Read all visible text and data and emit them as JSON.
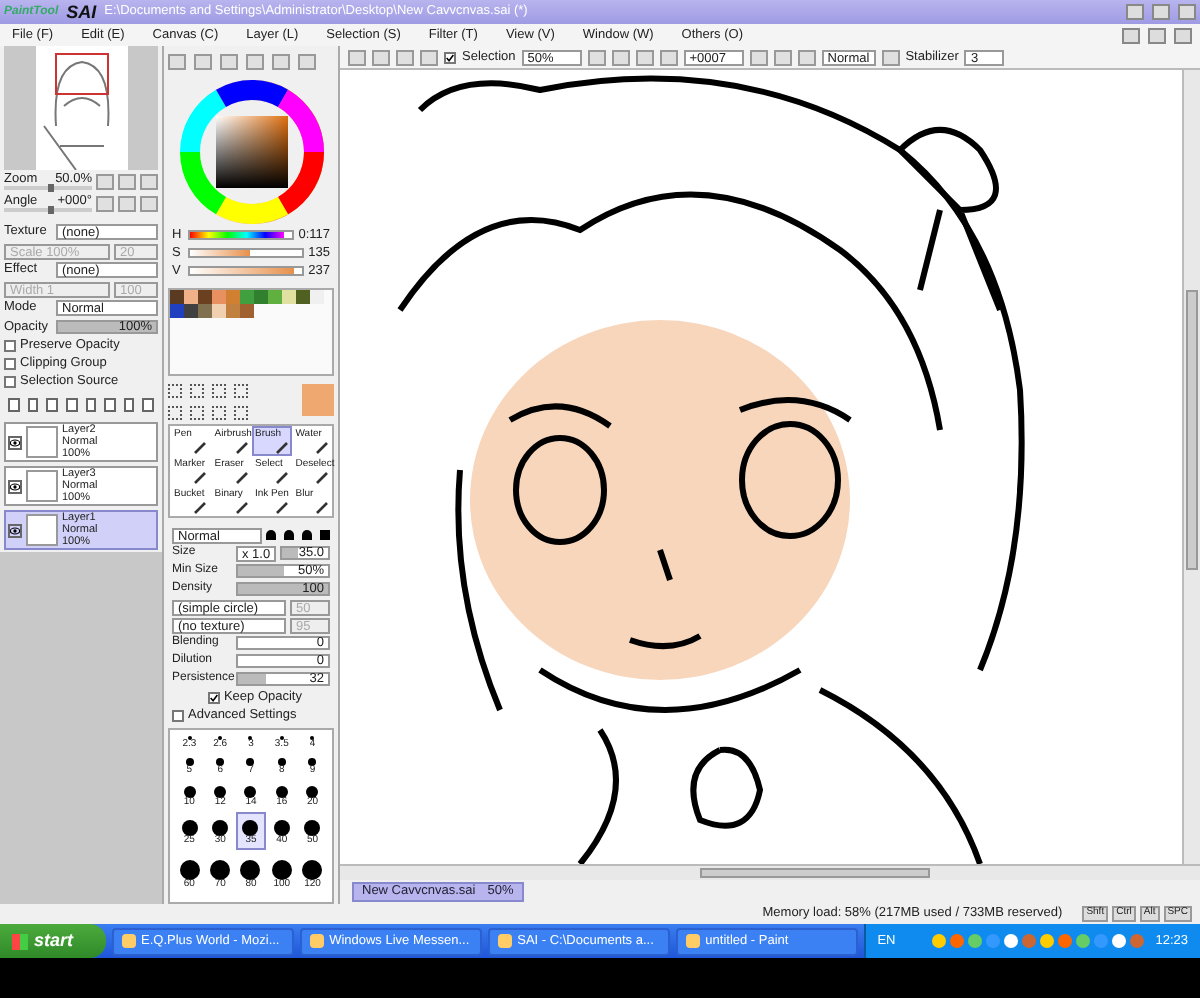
{
  "window": {
    "logo_small": "PaintTool",
    "logo": "SAI",
    "title": "E:\\Documents and Settings\\Administrator\\Desktop\\New Cavvcnvas.sai (*)"
  },
  "menu": [
    "File (F)",
    "Edit (E)",
    "Canvas (C)",
    "Layer (L)",
    "Selection (S)",
    "Filter (T)",
    "View (V)",
    "Window (W)",
    "Others (O)"
  ],
  "navigator": {
    "zoom": {
      "label": "Zoom",
      "value": "50.0%",
      "level": 0.5
    },
    "angle": {
      "label": "Angle",
      "value": "+000°",
      "level": 0.5
    }
  },
  "layer_props": {
    "fields": [
      {
        "label": "Texture",
        "value": "(none)",
        "sub_label": "Scale",
        "sub_value": "100%",
        "sub_extra": "20"
      },
      {
        "label": "Effect",
        "value": "(none)",
        "sub_label": "Width",
        "sub_value": "1",
        "sub_extra": "100"
      }
    ],
    "mode_label": "Mode",
    "mode": "Normal",
    "opacity": {
      "label": "Opacity",
      "value": "100%",
      "level": 1
    },
    "options": [
      {
        "label": "Preserve Opacity",
        "checked": false
      },
      {
        "label": "Clipping Group",
        "checked": false
      },
      {
        "label": "Selection Source",
        "checked": false
      }
    ]
  },
  "layers": [
    {
      "name": "Layer2",
      "mode": "Normal",
      "opacity": "100%",
      "visible": true,
      "selected": false
    },
    {
      "name": "Layer3",
      "mode": "Normal",
      "opacity": "100%",
      "visible": true,
      "selected": false
    },
    {
      "name": "Layer1",
      "mode": "Normal",
      "opacity": "100%",
      "visible": true,
      "selected": true
    }
  ],
  "color": {
    "sliders": [
      {
        "label": "H",
        "value": "0:117",
        "level": 0.92
      },
      {
        "label": "S",
        "value": "135",
        "level": 0.53
      },
      {
        "label": "V",
        "value": "237",
        "level": 0.93
      }
    ],
    "swatches": [
      {
        "color": "#5a3a20"
      },
      {
        "color": "#f0b088"
      },
      {
        "color": "#6a4020"
      },
      {
        "color": "#e89060"
      },
      {
        "color": "#d08030"
      },
      {
        "color": "#40a040"
      },
      {
        "color": "#308030"
      },
      {
        "color": "#60b040"
      },
      {
        "color": "#e0e0a0"
      },
      {
        "color": "#506020"
      },
      {
        "color": "#f0f0f0"
      },
      {
        "color": "#2040c0"
      },
      {
        "color": "#404040"
      },
      {
        "color": "#807050"
      },
      {
        "color": "#f0d0b0"
      },
      {
        "color": "#c08040"
      },
      {
        "color": "#a06030"
      }
    ]
  },
  "tools": [
    {
      "name": "Pen",
      "selected": false
    },
    {
      "name": "Airbrush",
      "selected": false
    },
    {
      "name": "Brush",
      "selected": true
    },
    {
      "name": "Water",
      "selected": false
    },
    {
      "name": "Marker",
      "selected": false
    },
    {
      "name": "Eraser",
      "selected": false
    },
    {
      "name": "Select",
      "selected": false
    },
    {
      "name": "Deselect",
      "selected": false
    },
    {
      "name": "Bucket",
      "selected": false
    },
    {
      "name": "Binary",
      "selected": false
    },
    {
      "name": "Ink Pen",
      "selected": false
    },
    {
      "name": "Blur",
      "selected": false
    }
  ],
  "brush": {
    "blend": "Normal",
    "size": {
      "label": "Size",
      "multiplier": "x 1.0",
      "value": "35.0",
      "level": 0.35
    },
    "params": [
      {
        "label": "Min Size",
        "value": "50%",
        "level": 0.5
      },
      {
        "label": "Density",
        "value": "100",
        "level": 1
      }
    ],
    "shape": "(simple circle)",
    "shape_value": "50",
    "texture": "(no texture)",
    "texture_value": "95",
    "mix": [
      {
        "label": "Blending",
        "value": "0",
        "level": 0
      },
      {
        "label": "Dilution",
        "value": "0",
        "level": 0
      },
      {
        "label": "Persistence",
        "value": "32",
        "level": 0.32
      }
    ],
    "keep_opacity": {
      "label": "Keep Opacity",
      "checked": true
    },
    "advanced": {
      "label": "Advanced Settings",
      "checked": false
    }
  },
  "brush_sizes": [
    {
      "label": "2.3",
      "selected": false
    },
    {
      "label": "2.6",
      "selected": false
    },
    {
      "label": "3",
      "selected": false
    },
    {
      "label": "3.5",
      "selected": false
    },
    {
      "label": "4",
      "selected": false
    },
    {
      "label": "5",
      "selected": false
    },
    {
      "label": "6",
      "selected": false
    },
    {
      "label": "7",
      "selected": false
    },
    {
      "label": "8",
      "selected": false
    },
    {
      "label": "9",
      "selected": false
    },
    {
      "label": "10",
      "selected": false
    },
    {
      "label": "12",
      "selected": false
    },
    {
      "label": "14",
      "selected": false
    },
    {
      "label": "16",
      "selected": false
    },
    {
      "label": "20",
      "selected": false
    },
    {
      "label": "25",
      "selected": false
    },
    {
      "label": "30",
      "selected": false
    },
    {
      "label": "35",
      "selected": true
    },
    {
      "label": "40",
      "selected": false
    },
    {
      "label": "50",
      "selected": false
    },
    {
      "label": "60",
      "selected": false
    },
    {
      "label": "70",
      "selected": false
    },
    {
      "label": "80",
      "selected": false
    },
    {
      "label": "100",
      "selected": false
    },
    {
      "label": "120",
      "selected": false
    }
  ],
  "toolbar": {
    "selection": {
      "label": "Selection",
      "checked": true
    },
    "zoom": "50%",
    "angle": "+0007",
    "blend": "Normal",
    "stabilizer_label": "Stabilizer",
    "stabilizer": "3"
  },
  "doc_tabs": [
    {
      "name": "New Cavvcnvas.sai",
      "zoom": "50%",
      "selected": true
    }
  ],
  "status": {
    "memory": "Memory load: 58% (217MB used / 733MB reserved)",
    "keys": [
      "Shft",
      "Ctrl",
      "Alt",
      "SPC"
    ]
  },
  "taskbar": {
    "start": "start",
    "tasks": [
      "E.Q.Plus World - Mozi...",
      "Windows Live Messen...",
      "SAI - C:\\Documents a...",
      "untitled - Paint"
    ],
    "language": "EN",
    "clock": "12:23"
  }
}
